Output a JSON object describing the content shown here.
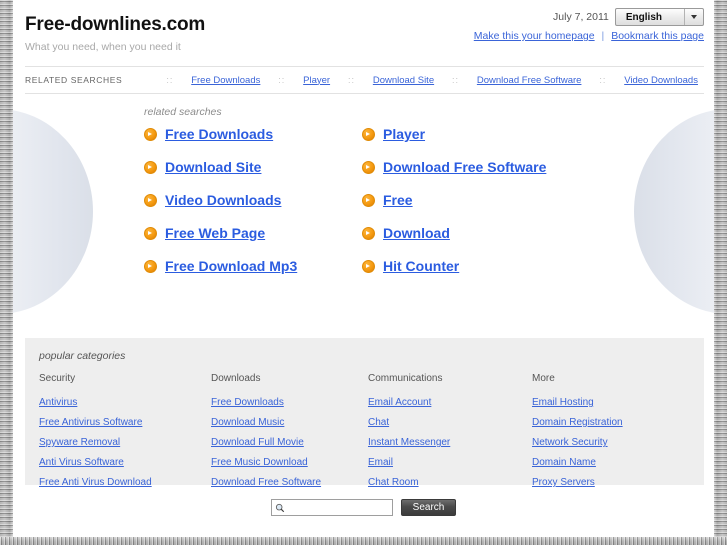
{
  "header": {
    "site_title": "Free-downlines.com",
    "tagline": "What you need, when you need it",
    "date": "July 7, 2011",
    "language_selected": "English",
    "homepage_link": "Make this your homepage",
    "bookmark_link": "Bookmark this page",
    "link_separator": "|"
  },
  "nav": {
    "label": "RELATED SEARCHES",
    "dots": "::",
    "items": [
      {
        "label": "Free Downloads"
      },
      {
        "label": "Player"
      },
      {
        "label": "Download Site"
      },
      {
        "label": "Download Free Software"
      },
      {
        "label": "Video Downloads"
      }
    ]
  },
  "related": {
    "heading": "related searches",
    "icon": "arrow-circle-right-icon",
    "links": [
      {
        "label": "Free Downloads"
      },
      {
        "label": "Player"
      },
      {
        "label": "Download Site"
      },
      {
        "label": "Download Free Software"
      },
      {
        "label": "Video Downloads"
      },
      {
        "label": "Free"
      },
      {
        "label": "Free Web Page"
      },
      {
        "label": "Download"
      },
      {
        "label": "Free Download Mp3"
      },
      {
        "label": "Hit Counter"
      }
    ]
  },
  "categories": {
    "heading": "popular categories",
    "columns": [
      {
        "title": "Security",
        "links": [
          "Antivirus",
          "Free Antivirus Software",
          "Spyware Removal",
          "Anti Virus Software",
          "Free Anti Virus Download"
        ]
      },
      {
        "title": "Downloads",
        "links": [
          "Free Downloads",
          "Download Music",
          "Download Full Movie",
          "Free Music Download",
          "Download Free Software"
        ]
      },
      {
        "title": "Communications",
        "links": [
          "Email Account",
          "Chat",
          "Instant Messenger",
          "Email",
          "Chat Room"
        ]
      },
      {
        "title": "More",
        "links": [
          "Email Hosting",
          "Domain Registration",
          "Network Security",
          "Domain Name",
          "Proxy Servers"
        ]
      }
    ]
  },
  "search": {
    "value": "",
    "placeholder": "",
    "button_label": "Search",
    "icon": "magnifier-icon"
  },
  "colors": {
    "link_blue": "#3a64d8",
    "related_link_blue": "#2b5ce0",
    "arrow_orange": "#f59a10",
    "category_bg": "#eeeeee"
  }
}
